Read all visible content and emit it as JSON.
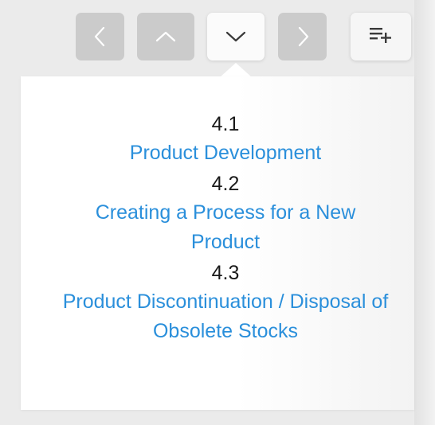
{
  "toolbar": {
    "buttons": [
      {
        "name": "previous-button",
        "icon": "chevron-left-icon"
      },
      {
        "name": "up-button",
        "icon": "chevron-up-icon"
      },
      {
        "name": "down-button",
        "icon": "chevron-down-icon",
        "active": true
      },
      {
        "name": "next-button",
        "icon": "chevron-right-icon"
      },
      {
        "name": "add-to-list-button",
        "icon": "playlist-add-icon"
      }
    ]
  },
  "toc": {
    "entries": [
      {
        "number": "4.1",
        "title": "Product Development"
      },
      {
        "number": "4.2",
        "title": "Creating a Process for a New Product"
      },
      {
        "number": "4.3",
        "title": "Product Discontinuation / Disposal of Obsolete Stocks"
      }
    ]
  },
  "colors": {
    "link": "#2a8fdb",
    "button_inactive": "#cbcbcb",
    "button_active": "#fbfbfb",
    "background": "#ebebeb"
  }
}
